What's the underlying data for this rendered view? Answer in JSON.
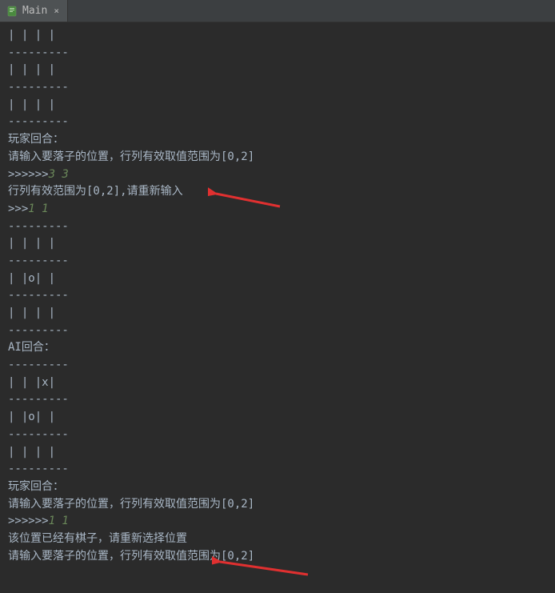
{
  "tab": {
    "label": "Main",
    "close": "×"
  },
  "console": {
    "lines": [
      {
        "text": "| | | |"
      },
      {
        "text": "---------"
      },
      {
        "text": "| | | |"
      },
      {
        "text": "---------"
      },
      {
        "text": "| | | |"
      },
      {
        "text": "---------"
      },
      {
        "text": "玩家回合："
      },
      {
        "text": "请输入要落子的位置，行列有效取值范围为[0,2]"
      },
      {
        "text": ">>>>>>3 3",
        "greenStart": 6
      },
      {
        "text": "行列有效范围为[0,2],请重新输入"
      },
      {
        "text": ">>>1 1",
        "greenStart": 3
      },
      {
        "text": "---------"
      },
      {
        "text": "| | | |"
      },
      {
        "text": "---------"
      },
      {
        "text": "| |o| |"
      },
      {
        "text": "---------"
      },
      {
        "text": "| | | |"
      },
      {
        "text": "---------"
      },
      {
        "text": "AI回合："
      },
      {
        "text": "---------"
      },
      {
        "text": "| | |x|"
      },
      {
        "text": "---------"
      },
      {
        "text": "| |o| |"
      },
      {
        "text": "---------"
      },
      {
        "text": "| | | |"
      },
      {
        "text": "---------"
      },
      {
        "text": "玩家回合："
      },
      {
        "text": "请输入要落子的位置，行列有效取值范围为[0,2]"
      },
      {
        "text": ">>>>>>1 1",
        "greenStart": 6
      },
      {
        "text": "该位置已经有棋子，请重新选择位置"
      },
      {
        "text": "请输入要落子的位置，行列有效取值范围为[0,2]"
      }
    ]
  },
  "watermark": ""
}
